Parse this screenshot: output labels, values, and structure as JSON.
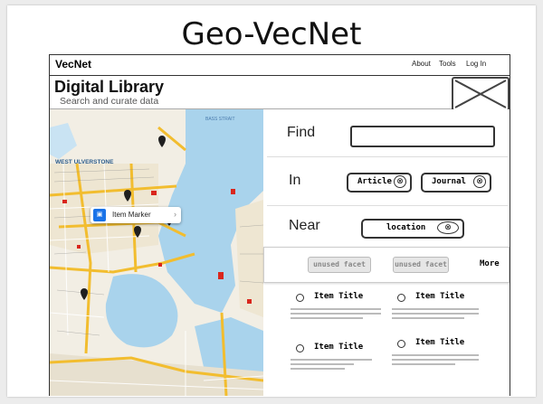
{
  "slide": {
    "title": "Geo-VecNet"
  },
  "topbar": {
    "brand": "VecNet",
    "nav": [
      "About",
      "Tools",
      "Log In"
    ]
  },
  "header": {
    "title": "Digital Library",
    "subtitle": "Search and curate data"
  },
  "map": {
    "labels": [
      "WEST ULVERSTONE",
      "BASS STRAIT"
    ],
    "marker_popup": {
      "label": "Item Marker",
      "icon": "car-icon"
    }
  },
  "search": {
    "find_label": "Find",
    "in_label": "In",
    "near_label": "Near",
    "find_value": "",
    "in_chips": [
      "Article",
      "Journal"
    ],
    "near_chip": "location",
    "remove_glyph": "⊗"
  },
  "facets": {
    "items": [
      "unused facet",
      "unused facet"
    ],
    "more": "More"
  },
  "results": [
    {
      "title": "Item Title"
    },
    {
      "title": "Item Title"
    },
    {
      "title": "Item Title"
    },
    {
      "title": "Item Title"
    }
  ],
  "colors": {
    "water": "#a9d3ec",
    "land": "#f3efe6",
    "road": "#f6c343",
    "marker": "#222222",
    "accent": "#1a73e8"
  }
}
